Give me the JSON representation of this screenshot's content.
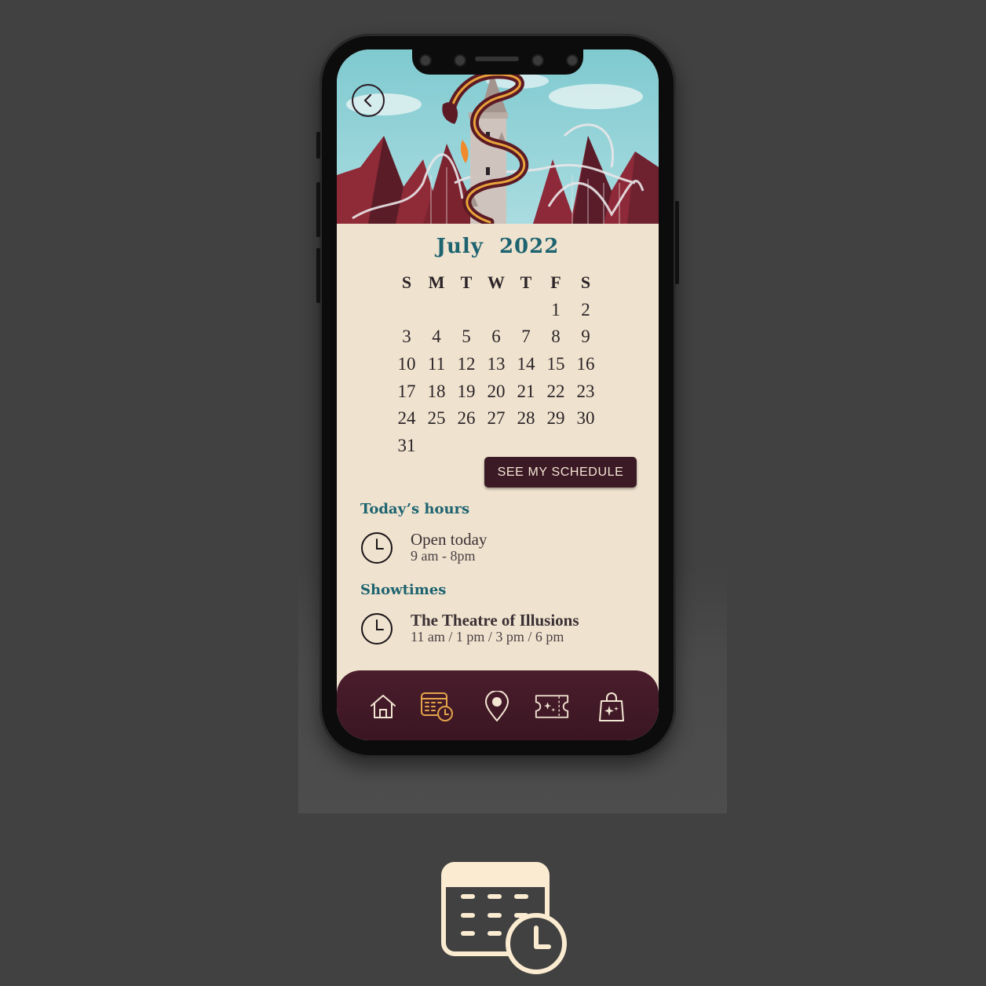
{
  "calendar": {
    "month": "July",
    "year": "2022",
    "weekdays": [
      "S",
      "M",
      "T",
      "W",
      "T",
      "F",
      "S"
    ],
    "days": [
      "",
      "",
      "",
      "",
      "",
      "1",
      "2",
      "3",
      "4",
      "5",
      "6",
      "7",
      "8",
      "9",
      "10",
      "11",
      "12",
      "13",
      "14",
      "15",
      "16",
      "17",
      "18",
      "19",
      "20",
      "21",
      "22",
      "23",
      "24",
      "25",
      "26",
      "27",
      "28",
      "29",
      "30",
      "31"
    ]
  },
  "schedule_button": {
    "label": "SEE MY SCHEDULE"
  },
  "hours": {
    "title": "Today’s hours",
    "status": "Open today",
    "time": "9 am - 8pm"
  },
  "showtimes": {
    "title": "Showtimes",
    "show_name": "The Theatre of Illusions",
    "times": "11 am / 1 pm / 3 pm / 6 pm"
  },
  "nav": {
    "items": [
      {
        "icon": "home-icon",
        "active": false
      },
      {
        "icon": "calendar-clock-icon",
        "active": true
      },
      {
        "icon": "map-pin-icon",
        "active": false
      },
      {
        "icon": "ticket-icon",
        "active": false
      },
      {
        "icon": "shopping-bag-icon",
        "active": false
      }
    ]
  },
  "colors": {
    "teal": "#1e6370",
    "maroon": "#3b1a26",
    "cream": "#efe3cf",
    "gold_active": "#e3a44a",
    "background": "#414141"
  }
}
